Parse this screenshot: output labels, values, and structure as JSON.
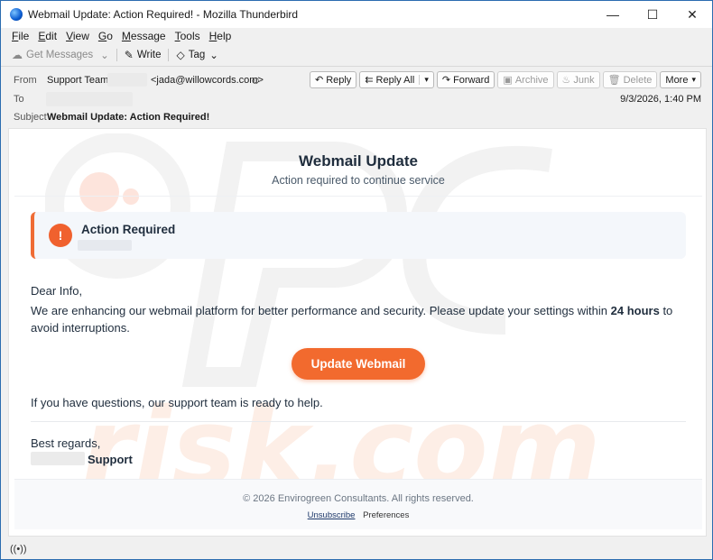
{
  "window": {
    "title": "Webmail Update: Action Required! - Mozilla Thunderbird",
    "controls": {
      "minimize": "—",
      "maximize": "☐",
      "close": "✕"
    }
  },
  "menubar": {
    "items": [
      {
        "first": "F",
        "rest": "ile"
      },
      {
        "first": "E",
        "rest": "dit"
      },
      {
        "first": "V",
        "rest": "iew"
      },
      {
        "first": "G",
        "rest": "o"
      },
      {
        "first": "M",
        "rest": "essage"
      },
      {
        "first": "T",
        "rest": "ools"
      },
      {
        "first": "H",
        "rest": "elp"
      }
    ]
  },
  "toolbar": {
    "get_messages": "Get Messages",
    "write": "Write",
    "tag": "Tag"
  },
  "header": {
    "from_label": "From",
    "from_name": "Support Team -",
    "from_email": "<jada@willowcords.com>",
    "to_label": "To",
    "subject_label": "Subject",
    "subject": "Webmail Update: Action Required!",
    "date": "9/3/2026, 1:40 PM",
    "actions": {
      "reply": "Reply",
      "reply_all": "Reply All",
      "forward": "Forward",
      "archive": "Archive",
      "junk": "Junk",
      "delete": "Delete",
      "more": "More"
    }
  },
  "email": {
    "title": "Webmail Update",
    "subtitle": "Action required to continue service",
    "alert_title": "Action Required",
    "alert_icon": "!",
    "greeting": "Dear Info,",
    "body_before": "We are enhancing our webmail platform for better performance and security. Please update your settings within ",
    "body_bold": "24 hours",
    "body_after": "  to avoid interruptions.",
    "cta": "Update Webmail",
    "help": "If you have questions, our support team is ready to help.",
    "regards": "Best regards,",
    "signature": "Support",
    "footer_copy": "© 2026 Envirogreen Consultants. All rights reserved.",
    "unsubscribe": "Unsubscribe",
    "preferences": "Preferences"
  },
  "watermark": {
    "text": "risk.com"
  },
  "icons": {
    "app": "thunderbird-icon",
    "accent_orange": "#f26a2e",
    "accent_navy": "#1f2d3d"
  }
}
